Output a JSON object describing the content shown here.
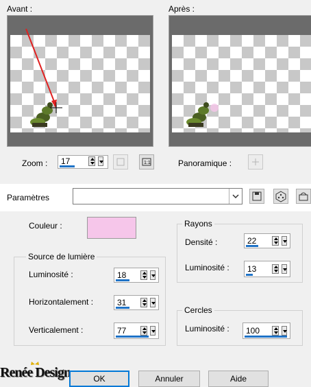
{
  "preview": {
    "before_label": "Avant :",
    "after_label": "Après :"
  },
  "zoom": {
    "label": "Zoom :",
    "value": "17"
  },
  "panoramique": {
    "label": "Panoramique :"
  },
  "parametres": {
    "label": "Paramètres",
    "value": ""
  },
  "couleur": {
    "label": "Couleur :",
    "swatch": "#f6c6ea"
  },
  "source_lumiere": {
    "title": "Source de lumière",
    "luminosite": {
      "label": "Luminosité :",
      "value": "18",
      "level": 18
    },
    "horizontalement": {
      "label": "Horizontalement :",
      "value": "31",
      "level": 31
    },
    "verticalement": {
      "label": "Verticalement :",
      "value": "77",
      "level": 77
    }
  },
  "rayons": {
    "title": "Rayons",
    "densite": {
      "label": "Densité :",
      "value": "22",
      "level": 22
    },
    "luminosite": {
      "label": "Luminosité :",
      "value": "13",
      "level": 13
    }
  },
  "cercles": {
    "title": "Cercles",
    "luminosite": {
      "label": "Luminosité :",
      "value": "100",
      "level": 100
    }
  },
  "buttons": {
    "ok": "OK",
    "annuler": "Annuler",
    "aide": "Aide"
  },
  "watermark": "Renée Design",
  "colors": {
    "accent": "#1f73c7",
    "arrow": "#e02020",
    "soldier": "#5d7a2a"
  }
}
